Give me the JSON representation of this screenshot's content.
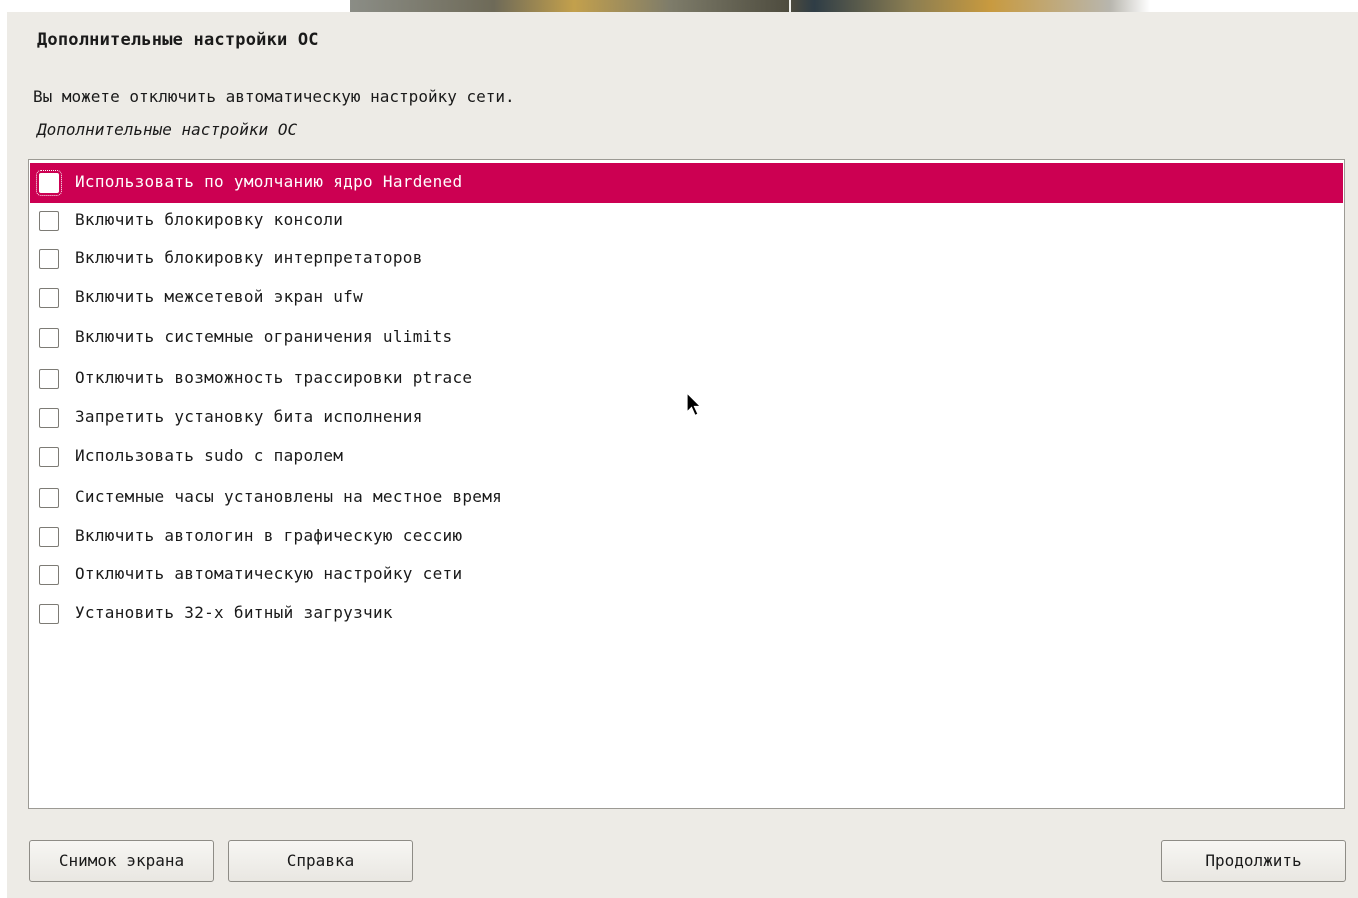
{
  "page": {
    "title": "Дополнительные настройки ОС",
    "description": "Вы можете отключить автоматическую настройку сети.",
    "subheading": "Дополнительные настройки ОС"
  },
  "options": [
    {
      "label": "Использовать по умолчанию ядро Hardened",
      "checked": false,
      "selected": true
    },
    {
      "label": "Включить блокировку консоли",
      "checked": false
    },
    {
      "label": "Включить блокировку интерпретаторов",
      "checked": false
    },
    {
      "label": "Включить межсетевой экран ufw",
      "checked": false
    },
    {
      "label": "Включить системные ограничения ulimits",
      "checked": false
    },
    {
      "label": "Отключить возможность трассировки ptrace",
      "checked": false
    },
    {
      "label": "Запретить установку бита исполнения",
      "checked": false
    },
    {
      "label": "Использовать sudo с паролем",
      "checked": false
    },
    {
      "label": "Системные часы установлены на местное время",
      "checked": false
    },
    {
      "label": "Включить автологин в графическую сессию",
      "checked": false
    },
    {
      "label": "Отключить автоматическую настройку сети",
      "checked": false
    },
    {
      "label": "Установить 32-х битный загрузчик",
      "checked": false
    }
  ],
  "buttons": {
    "screenshot": "Снимок экрана",
    "help": "Справка",
    "continue": "Продолжить"
  },
  "colors": {
    "selection": "#cc0052",
    "panel_background": "#edebe6"
  },
  "icons": {
    "cursor": "mouse-pointer-icon"
  }
}
